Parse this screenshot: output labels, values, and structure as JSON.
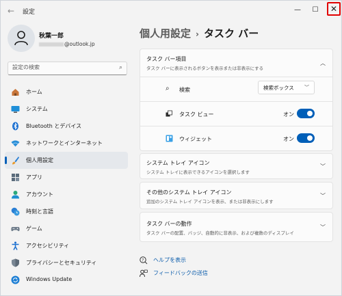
{
  "window": {
    "title": "設定"
  },
  "user": {
    "name": "秋葉一郎",
    "email_visible": "@outlook.jp"
  },
  "search": {
    "placeholder": "設定の検索"
  },
  "sidebar": {
    "items": [
      {
        "label": "ホーム",
        "icon": "home-icon"
      },
      {
        "label": "システム",
        "icon": "display-icon"
      },
      {
        "label": "Bluetooth とデバイス",
        "icon": "bluetooth-icon"
      },
      {
        "label": "ネットワークとインターネット",
        "icon": "wifi-icon"
      },
      {
        "label": "個人用設定",
        "icon": "brush-icon",
        "active": true
      },
      {
        "label": "アプリ",
        "icon": "apps-icon"
      },
      {
        "label": "アカウント",
        "icon": "person-icon"
      },
      {
        "label": "時刻と言語",
        "icon": "clock-globe-icon"
      },
      {
        "label": "ゲーム",
        "icon": "gamepad-icon"
      },
      {
        "label": "アクセシビリティ",
        "icon": "accessibility-icon"
      },
      {
        "label": "プライバシーとセキュリティ",
        "icon": "shield-icon"
      },
      {
        "label": "Windows Update",
        "icon": "refresh-icon"
      }
    ]
  },
  "breadcrumb": {
    "parent": "個人用設定",
    "separator": "›",
    "current": "タスク バー"
  },
  "sections": {
    "taskbar_items": {
      "title": "タスク バー項目",
      "subtitle": "タスク バーに表示されるボタンを表示または非表示にする",
      "rows": {
        "search": {
          "label": "検索",
          "dropdown_value": "検索ボックス"
        },
        "task_view": {
          "label": "タスク ビュー",
          "toggle_label": "オン"
        },
        "widgets": {
          "label": "ウィジェット",
          "toggle_label": "オン"
        }
      }
    },
    "system_tray": {
      "title": "システム トレイ アイコン",
      "subtitle": "システム トレイに表示できるアイコンを選択します"
    },
    "other_tray": {
      "title": "その他のシステム トレイ アイコン",
      "subtitle": "追加のシステム トレイ アイコンを表示、または非表示にします"
    },
    "behavior": {
      "title": "タスク バーの動作",
      "subtitle": "タスク バーの配置、バッジ、自動的に非表示、および複数のディスプレイ"
    }
  },
  "links": {
    "help": "ヘルプを表示",
    "feedback": "フィードバックの送信"
  },
  "colors": {
    "accent": "#005fb8",
    "highlight_border": "#e10000"
  }
}
